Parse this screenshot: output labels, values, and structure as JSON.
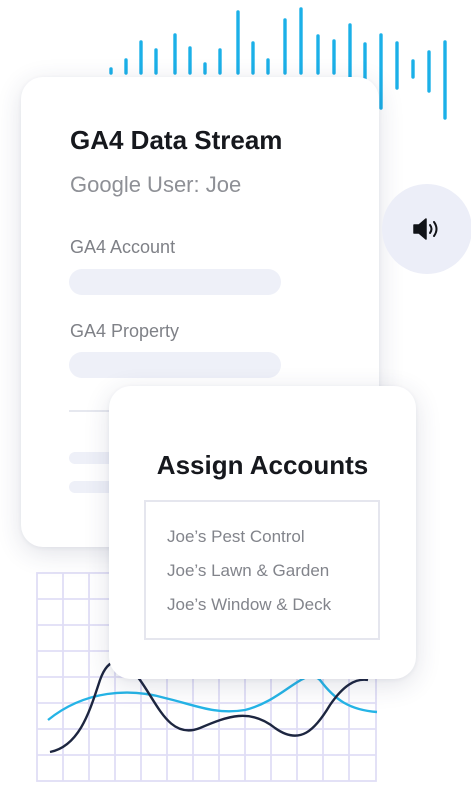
{
  "ga4_card": {
    "title": "GA4 Data Stream",
    "subtitle": "Google User: Joe",
    "account_label": "GA4 Account",
    "property_label": "GA4 Property"
  },
  "assign_card": {
    "title": "Assign Accounts",
    "accounts": [
      "Joe’s Pest Control",
      "Joe’s Lawn & Garden",
      "Joe’s Window & Deck"
    ]
  },
  "speaker": {
    "icon": "speaker-icon"
  },
  "colors": {
    "waveform": "#1bb0e8",
    "grid": "#e0def6",
    "line_dark": "#1d2640",
    "line_light": "#25b4e6",
    "placeholder": "#eef0f8",
    "speaker_bg": "#eceef8"
  }
}
